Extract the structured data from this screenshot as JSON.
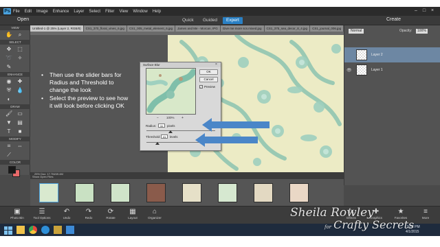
{
  "window": {
    "logo": "Ps",
    "menu": [
      "File",
      "Edit",
      "Image",
      "Enhance",
      "Layer",
      "Select",
      "Filter",
      "View",
      "Window",
      "Help"
    ],
    "controls": [
      "–",
      "□",
      "×"
    ]
  },
  "modebar": {
    "open_label": "Open",
    "tabs": [
      "Quick",
      "Guided",
      "Expert"
    ],
    "active_tab": "Expert",
    "create_label": "Create"
  },
  "doc_tabs": [
    "Untitled-1 @ 25% (Layer 2, RGB/8)",
    "CS1_370_floral_vines_6.jpg",
    "CS1_005_metal_element_6.jpg",
    "James and Me - Morcan, IPG",
    "Give me more scs.mixed.jpg",
    "CS1_375_sea_decor_8_4.jpg",
    "CS1_journal_006.jpg"
  ],
  "toolbar": {
    "sections": [
      "VIEW",
      "SELECT",
      "ENHANCE",
      "DRAW",
      "MODIFY",
      "COLOR"
    ],
    "colors": {
      "foreground": "#1a1a1a",
      "background": "#e86a6a"
    }
  },
  "canvas": {
    "status_text": "25%   Doc: 17.7M/49.4M",
    "accent_color": "#2a80c4"
  },
  "slide": {
    "bullets": [
      "Then use the slider bars for Radius and Threshold to change the look",
      "Select the preview to see how it will look before clicking OK"
    ],
    "arrow_color": "#4a86c8"
  },
  "dialog": {
    "title": "Surface Blur",
    "ok_label": "OK",
    "cancel_label": "Cancel",
    "preview_label": "Preview",
    "zoom": "100%",
    "radius_label": "Radius:",
    "radius_value": "11",
    "radius_unit": "pixels",
    "threshold_label": "Threshold:",
    "threshold_value": "41",
    "threshold_unit": "levels",
    "radius_fraction": 0.35,
    "threshold_fraction": 0.16
  },
  "layers": {
    "blend_mode": "Normal",
    "opacity_label": "Opacity:",
    "opacity_value": "100%",
    "items": [
      "Layer 2",
      "Layer 1"
    ]
  },
  "photo_bin": {
    "header": "Show Open Files"
  },
  "bottom_bar": {
    "left": [
      {
        "label": "Photo Bin",
        "icon": "photo-bin-icon"
      },
      {
        "label": "Tool Options",
        "icon": "tool-options-icon"
      },
      {
        "label": "Undo",
        "icon": "undo-icon"
      },
      {
        "label": "Redo",
        "icon": "redo-icon"
      },
      {
        "label": "Rotate",
        "icon": "rotate-icon"
      },
      {
        "label": "Layout",
        "icon": "layout-icon"
      },
      {
        "label": "Organizer",
        "icon": "organizer-icon"
      }
    ],
    "right": [
      {
        "label": "Effects",
        "icon": "effects-icon"
      },
      {
        "label": "Graphics",
        "icon": "graphics-icon"
      },
      {
        "label": "Favorites",
        "icon": "favorites-icon"
      },
      {
        "label": "More",
        "icon": "more-icon"
      }
    ]
  },
  "taskbar": {
    "time": "9:52 PM",
    "date": "4/1/2015"
  },
  "watermark": {
    "line1": "Sheila Rowley",
    "for": "for",
    "line2": "Crafty Secrets"
  }
}
